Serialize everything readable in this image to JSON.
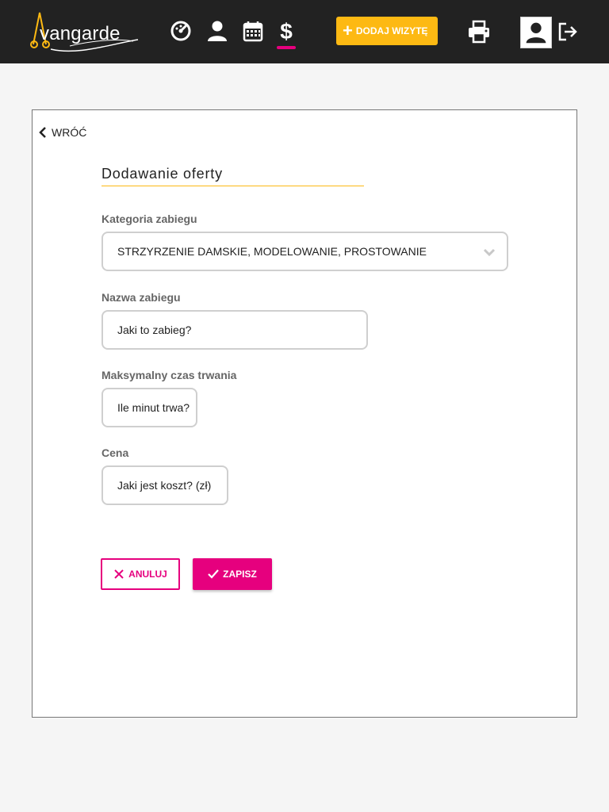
{
  "app": {
    "logo_text": "vangarde"
  },
  "header": {
    "add_visit_label": "DODAJ WIZYTĘ",
    "nav": [
      "dashboard-icon",
      "user-icon",
      "calendar-icon",
      "dollar-icon"
    ],
    "active_nav": "dollar-icon"
  },
  "card": {
    "back_label": "WRÓĆ",
    "title": "Dodawanie oferty"
  },
  "form": {
    "category": {
      "label": "Kategoria zabiegu",
      "value": "STRZYRZENIE DAMSKIE, MODELOWANIE, PROSTOWANIE"
    },
    "name": {
      "label": "Nazwa zabiegu",
      "placeholder": "Jaki to zabieg?"
    },
    "duration": {
      "label": "Maksymalny czas trwania",
      "placeholder": "Ile minut trwa?"
    },
    "price": {
      "label": "Cena",
      "placeholder": "Jaki jest koszt? (zł)"
    }
  },
  "actions": {
    "cancel_label": "ANULUJ",
    "save_label": "ZAPISZ"
  },
  "colors": {
    "accent_pink": "#e6007e",
    "accent_yellow": "#fdb913",
    "topbar": "#222222"
  }
}
